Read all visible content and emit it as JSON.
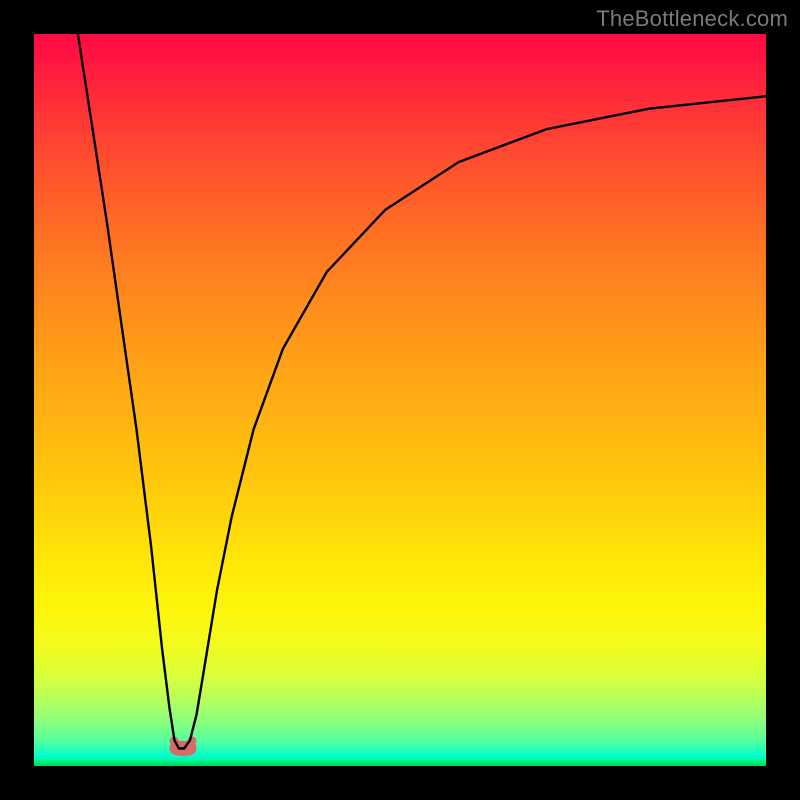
{
  "watermark": {
    "text": "TheBottleneck.com"
  },
  "chart_data": {
    "type": "line",
    "title": "",
    "xlabel": "",
    "ylabel": "",
    "xlim": [
      0,
      100
    ],
    "ylim": [
      0,
      100
    ],
    "grid": false,
    "legend": false,
    "background": {
      "style": "vertical-gradient",
      "stops": [
        {
          "pos": 0,
          "color": "#ff0a44"
        },
        {
          "pos": 0.15,
          "color": "#ff4531"
        },
        {
          "pos": 0.4,
          "color": "#ff951a"
        },
        {
          "pos": 0.62,
          "color": "#ffca0c"
        },
        {
          "pos": 0.79,
          "color": "#fdf70c"
        },
        {
          "pos": 0.91,
          "color": "#b4ff5e"
        },
        {
          "pos": 0.986,
          "color": "#00ffce"
        },
        {
          "pos": 1.0,
          "color": "#00d84c"
        }
      ]
    },
    "series": [
      {
        "name": "bottleneck-curve",
        "color": "#000000",
        "x": [
          6.0,
          8.0,
          10.0,
          12.0,
          14.0,
          16.0,
          17.5,
          18.5,
          19.2,
          19.8,
          20.5,
          21.3,
          22.2,
          23.2,
          25.0,
          27.0,
          30.0,
          34.0,
          40.0,
          48.0,
          58.0,
          70.0,
          84.0,
          100.0
        ],
        "y": [
          100.0,
          87.0,
          74.0,
          60.0,
          46.0,
          30.0,
          16.0,
          8.0,
          3.5,
          2.4,
          2.4,
          3.5,
          7.0,
          13.0,
          24.0,
          34.0,
          46.0,
          57.0,
          67.5,
          76.0,
          82.5,
          87.0,
          89.8,
          91.5
        ]
      }
    ],
    "markers": [
      {
        "name": "minimum-marker",
        "shape": "rounded-blob",
        "color": "#d86a6a",
        "x_range": [
          19.0,
          21.5
        ],
        "y": 2.4
      }
    ]
  }
}
